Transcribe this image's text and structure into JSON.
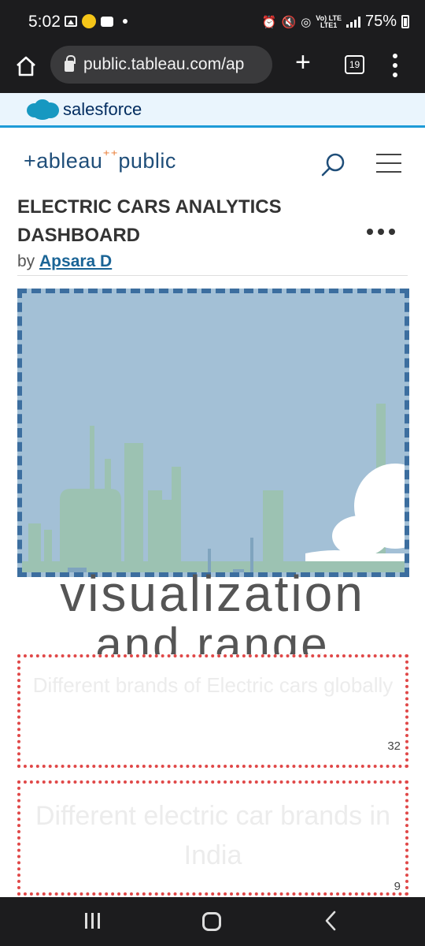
{
  "status_bar": {
    "time": "5:02",
    "network_label_top": "Vo) LTE",
    "network_label_bottom": "LTE1",
    "battery": "75%"
  },
  "browser": {
    "url": "public.tableau.com/ap",
    "tab_count": "19"
  },
  "banner": {
    "brand": "salesforce"
  },
  "header": {
    "logo_left": "+ableau",
    "logo_right": "public"
  },
  "page": {
    "title": "ELECTRIC CARS ANALYTICS DASHBOARD",
    "byline_prefix": "by ",
    "author": "Apsara D"
  },
  "dashboard": {
    "heading_line1": "visualization",
    "heading_line2": "and range",
    "cards": [
      {
        "title": "Different brands of Electric cars globally",
        "count": "32"
      },
      {
        "title": "Different electric car brands in India",
        "count": "9"
      }
    ]
  }
}
